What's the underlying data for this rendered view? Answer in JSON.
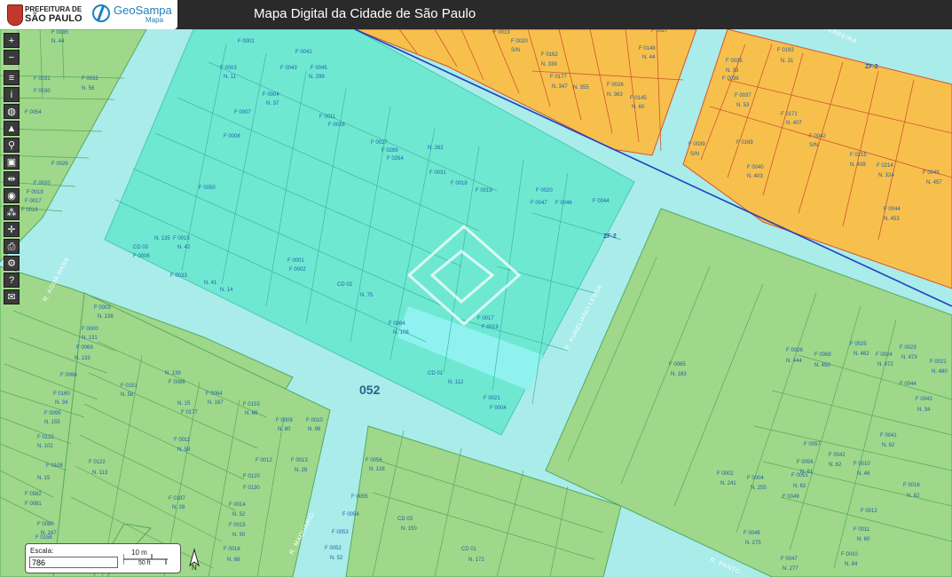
{
  "header": {
    "prefeitura_line1": "PREFEITURA DE",
    "prefeitura_line2": "SÃO PAULO",
    "brand": "GeoSampa",
    "brand_sub": "Mapa",
    "title": "Mapa Digital da Cidade de São Paulo"
  },
  "toolbar": {
    "zoom_in": "+",
    "zoom_out": "−",
    "layers": "≡",
    "info": "i",
    "globe": "◍",
    "pointer": "▲",
    "search": "⚲",
    "save": "▣",
    "measure": "⇹",
    "film": "◉",
    "pattern": "⁂",
    "crosshair": "✛",
    "print": "⎙",
    "settings": "⚙",
    "help": "?",
    "mail": "✉"
  },
  "scale": {
    "label": "Escala:",
    "value": "786",
    "metric": "10 m",
    "imperial": "50 ft",
    "north": "N"
  },
  "map": {
    "block_number": "052",
    "zone_labels": [
      "ZF-2",
      "ZF-2"
    ],
    "streets": [
      "R. AGUA RASA",
      "R. AURELIANO LESSA",
      "R. MAQUARIO",
      "R. PANTO ...",
      "R. ... FERREIRA"
    ],
    "lots": [
      {
        "text": "F 0035"
      },
      {
        "text": "N. 44"
      },
      {
        "text": "F 0031"
      },
      {
        "text": "F 0032"
      },
      {
        "text": "F 0030"
      },
      {
        "text": "N. 56"
      },
      {
        "text": "F 0054"
      },
      {
        "text": "F 0026"
      },
      {
        "text": "F 0020"
      },
      {
        "text": "F 0019"
      },
      {
        "text": "F 0017"
      },
      {
        "text": "F 0016"
      },
      {
        "text": "F 0015"
      },
      {
        "text": "N. 42"
      },
      {
        "text": "F 0001"
      },
      {
        "text": "F 0003"
      },
      {
        "text": "N. 11"
      },
      {
        "text": "F 0041"
      },
      {
        "text": "F 0043"
      },
      {
        "text": "F 0045"
      },
      {
        "text": "N. 299"
      },
      {
        "text": "F 0004"
      },
      {
        "text": "N. 37"
      },
      {
        "text": "F 0007"
      },
      {
        "text": "F 0008"
      },
      {
        "text": "F 0011"
      },
      {
        "text": "F 0028"
      },
      {
        "text": "F 0027"
      },
      {
        "text": "F 0289"
      },
      {
        "text": "F 0264"
      },
      {
        "text": "N. 262"
      },
      {
        "text": "F 0018"
      },
      {
        "text": "F 0031"
      },
      {
        "text": "F 0019"
      },
      {
        "text": "F 0020"
      },
      {
        "text": "F 0046"
      },
      {
        "text": "F 0047"
      },
      {
        "text": "F 0044"
      },
      {
        "text": "F 0050"
      },
      {
        "text": "CD 03"
      },
      {
        "text": "F 0006"
      },
      {
        "text": "N. 135"
      },
      {
        "text": "F 0033"
      },
      {
        "text": "N. 41"
      },
      {
        "text": "N. 14"
      },
      {
        "text": "F 0001"
      },
      {
        "text": "F 0002"
      },
      {
        "text": "CD 02"
      },
      {
        "text": "N. 75"
      },
      {
        "text": "F 0017"
      },
      {
        "text": "F 0019"
      },
      {
        "text": "F 0064"
      },
      {
        "text": "N. 108"
      },
      {
        "text": "CD 01"
      },
      {
        "text": "N. 112"
      },
      {
        "text": "F 0021"
      },
      {
        "text": "F 0004"
      },
      {
        "text": "F 0003"
      },
      {
        "text": "N. 138"
      },
      {
        "text": "F 0000"
      },
      {
        "text": "N. 131"
      },
      {
        "text": "F 0069"
      },
      {
        "text": "N. 133"
      },
      {
        "text": "F 0066"
      },
      {
        "text": "N. 139"
      },
      {
        "text": "F 0086"
      },
      {
        "text": "F 0151"
      },
      {
        "text": "N. 58"
      },
      {
        "text": "F 0160"
      },
      {
        "text": "N. 34"
      },
      {
        "text": "F 0095"
      },
      {
        "text": "N. 155"
      },
      {
        "text": "F 0064"
      },
      {
        "text": "N. 167"
      },
      {
        "text": "F 0153"
      },
      {
        "text": "N. 66"
      },
      {
        "text": "F 0009"
      },
      {
        "text": "N. 80"
      },
      {
        "text": "F 0010"
      },
      {
        "text": "N. 96"
      },
      {
        "text": "F 0122"
      },
      {
        "text": "N. 102"
      },
      {
        "text": "F 0122"
      },
      {
        "text": "N. 113"
      },
      {
        "text": "F 0108"
      },
      {
        "text": "N. 15"
      },
      {
        "text": "F 0582"
      },
      {
        "text": "F 0081"
      },
      {
        "text": "F 0080"
      },
      {
        "text": "N. 167"
      },
      {
        "text": "F 0158"
      },
      {
        "text": "N. 15"
      },
      {
        "text": "F 0177"
      },
      {
        "text": "F 0011"
      },
      {
        "text": "N. 58"
      },
      {
        "text": "F 0012"
      },
      {
        "text": "F 0120"
      },
      {
        "text": "F 0130"
      },
      {
        "text": "F 0014"
      },
      {
        "text": "N. 52"
      },
      {
        "text": "F 0015"
      },
      {
        "text": "N. 50"
      },
      {
        "text": "F 0187"
      },
      {
        "text": "N. 28"
      },
      {
        "text": "F 0016"
      },
      {
        "text": "N. 68"
      },
      {
        "text": "F 0013"
      },
      {
        "text": "N. 28"
      },
      {
        "text": "F 0056"
      },
      {
        "text": "N. 128"
      },
      {
        "text": "F 0055"
      },
      {
        "text": "F 0054"
      },
      {
        "text": "F 0053"
      },
      {
        "text": "F 0052"
      },
      {
        "text": "N. 52"
      },
      {
        "text": "CD 03"
      },
      {
        "text": "N. 150"
      },
      {
        "text": "CD 01"
      },
      {
        "text": "N. 172"
      },
      {
        "text": "F 0019"
      },
      {
        "text": "F 0020"
      },
      {
        "text": "S/N"
      },
      {
        "text": "F 0162"
      },
      {
        "text": "N. 339"
      },
      {
        "text": "F 0148"
      },
      {
        "text": "N. 44"
      },
      {
        "text": "F 0027"
      },
      {
        "text": "F 0177"
      },
      {
        "text": "N. 347"
      },
      {
        "text": "N. 355"
      },
      {
        "text": "F 0026"
      },
      {
        "text": "N. 363"
      },
      {
        "text": "F 0145"
      },
      {
        "text": "N. 60"
      },
      {
        "text": "F 0193"
      },
      {
        "text": "F 0035"
      },
      {
        "text": "N. 31"
      },
      {
        "text": "N. 33"
      },
      {
        "text": "F 0036"
      },
      {
        "text": "F 0037"
      },
      {
        "text": "N. 53"
      },
      {
        "text": "F 0171"
      },
      {
        "text": "N. 407"
      },
      {
        "text": "F 0039"
      },
      {
        "text": "S/N"
      },
      {
        "text": "F 0169"
      },
      {
        "text": "F 0042"
      },
      {
        "text": "S/N"
      },
      {
        "text": "F 0040"
      },
      {
        "text": "N. 403"
      },
      {
        "text": "F 0215"
      },
      {
        "text": "N. 439"
      },
      {
        "text": "F 0214"
      },
      {
        "text": "N. 324"
      },
      {
        "text": "F 0045"
      },
      {
        "text": "N. 457"
      },
      {
        "text": "F 0044"
      },
      {
        "text": "N. 453"
      },
      {
        "text": "F 0065"
      },
      {
        "text": "N. 183"
      },
      {
        "text": "F 0028"
      },
      {
        "text": "N. 444"
      },
      {
        "text": "F 0068"
      },
      {
        "text": "N. 450"
      },
      {
        "text": "F 0025"
      },
      {
        "text": "N. 462"
      },
      {
        "text": "F 0024"
      },
      {
        "text": "N. 472"
      },
      {
        "text": "F 0023"
      },
      {
        "text": "N. 473"
      },
      {
        "text": "F 0021"
      },
      {
        "text": "N. 480"
      },
      {
        "text": "F 0044"
      },
      {
        "text": "F 0043"
      },
      {
        "text": "N. 34"
      },
      {
        "text": "F 0057"
      },
      {
        "text": "F 0042"
      },
      {
        "text": "N. 62"
      },
      {
        "text": "F 0041"
      },
      {
        "text": "N. 62"
      },
      {
        "text": "F 0010"
      },
      {
        "text": "N. 46"
      },
      {
        "text": "F 0056"
      },
      {
        "text": "N. 61"
      },
      {
        "text": "F 0016"
      },
      {
        "text": "N. 62"
      },
      {
        "text": "F 0002"
      },
      {
        "text": "N. 241"
      },
      {
        "text": "F 0004"
      },
      {
        "text": "N. 255"
      },
      {
        "text": "F 0051"
      },
      {
        "text": "N. 62"
      },
      {
        "text": "F 0049"
      },
      {
        "text": "F 0012"
      },
      {
        "text": "F 0046"
      },
      {
        "text": "N. 275"
      },
      {
        "text": "F 0047"
      },
      {
        "text": "N. 277"
      },
      {
        "text": "F 0011"
      },
      {
        "text": "N. 60"
      },
      {
        "text": "F 0010"
      },
      {
        "text": "N. 84"
      }
    ]
  },
  "colors": {
    "street": "#a9ecea",
    "block_green": "#9fd88a",
    "block_selected": "#6fe8d2",
    "block_orange": "#f7c04d",
    "lot_line": "#57a85f",
    "orange_line": "#d1542f",
    "label": "#1f5fa8"
  }
}
